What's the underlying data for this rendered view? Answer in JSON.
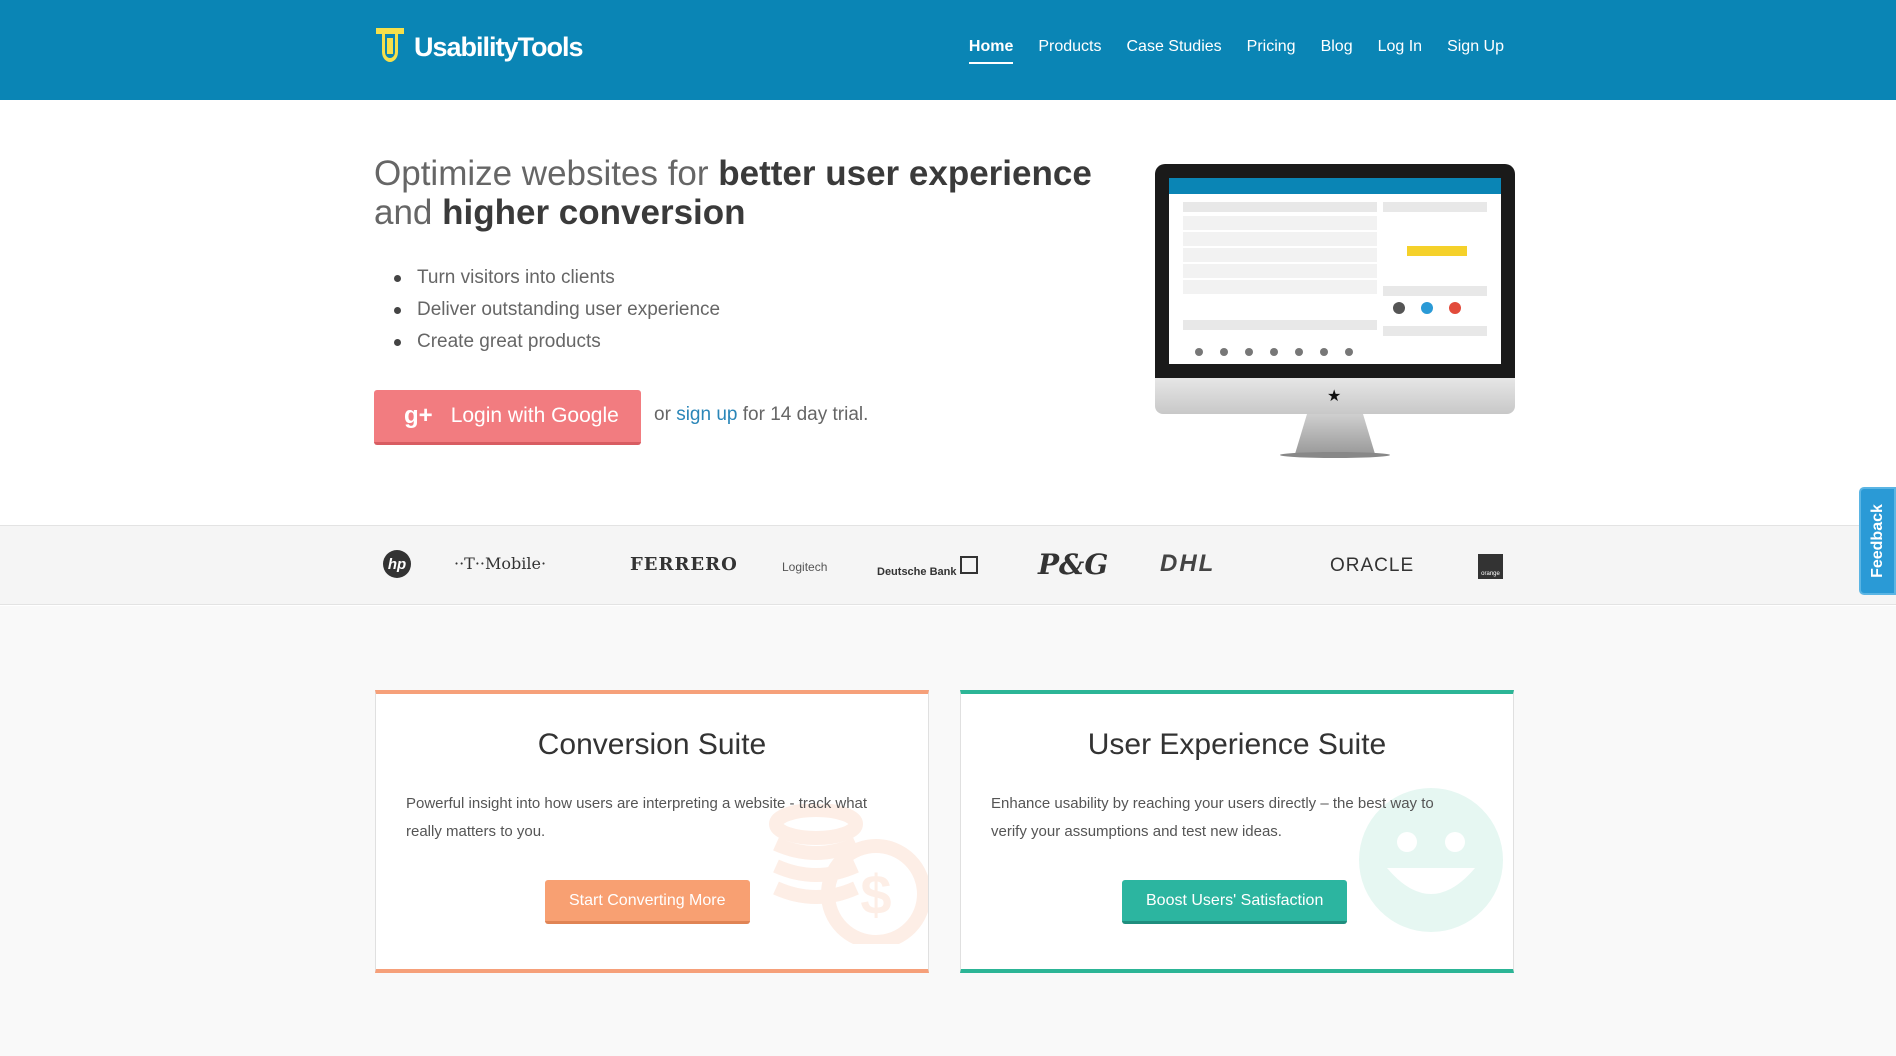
{
  "header": {
    "logo_text": "UsabilityTools",
    "nav": [
      {
        "label": "Home",
        "active": true
      },
      {
        "label": "Products"
      },
      {
        "label": "Case Studies"
      },
      {
        "label": "Pricing"
      },
      {
        "label": "Blog"
      },
      {
        "label": "Log In"
      },
      {
        "label": "Sign Up"
      }
    ]
  },
  "hero": {
    "title_part1": "Optimize websites for ",
    "title_bold1": "better user experience",
    "title_part2": "and ",
    "title_bold2": "higher conversion",
    "bullets": [
      "Turn visitors into clients",
      "Deliver outstanding user experience",
      "Create great products"
    ],
    "google_button": "Login with Google",
    "trial_prefix": "or ",
    "trial_link": "sign up",
    "trial_suffix": " for 14 day trial."
  },
  "clients": [
    "hp",
    "··T··Mobile·",
    "FERRERO",
    "Logitech",
    "Deutsche Bank",
    "P&G",
    "DHL",
    "ORACLE",
    "orange"
  ],
  "feedback_label": "Feedback",
  "cards": {
    "conversion": {
      "title": "Conversion Suite",
      "text": "Powerful insight into how users are interpreting a website - track what really matters to you.",
      "button": "Start Converting More"
    },
    "ux": {
      "title": "User Experience Suite",
      "text": "Enhance usability by reaching your users directly – the best way to verify your assumptions and test new ideas.",
      "button": "Boost Users' Satisfaction"
    }
  },
  "colors": {
    "header_bg": "#0a85b5",
    "google_btn": "#f27c80",
    "conversion_accent": "#f6a07a",
    "ux_accent": "#2cb596"
  }
}
